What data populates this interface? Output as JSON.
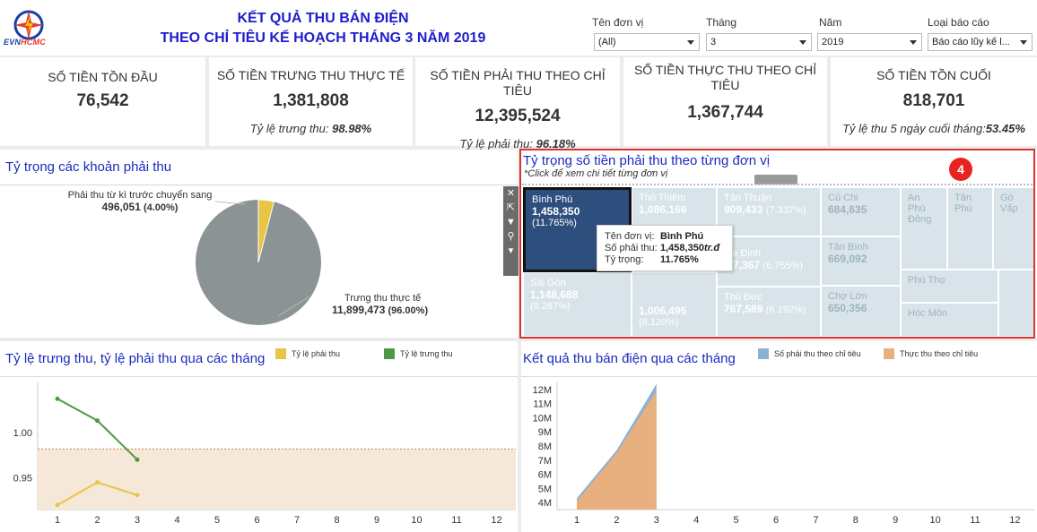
{
  "header": {
    "logo_text_a": "EVN",
    "logo_text_b": "HCMC",
    "title_line1": "KẾT QUẢ THU BÁN ĐIỆN",
    "title_line2": "THEO CHỈ TIÊU KẾ HOẠCH THÁNG 3 NĂM 2019"
  },
  "filters": [
    {
      "label": "Tên đơn vị",
      "value": "(All)"
    },
    {
      "label": "Tháng",
      "value": "3"
    },
    {
      "label": "Năm",
      "value": "2019"
    },
    {
      "label": "Loại báo cáo",
      "value": "Báo cáo lũy kế l..."
    }
  ],
  "kpis": [
    {
      "title": "SỐ TIỀN TỒN ĐẦU",
      "value": "76,542",
      "note_label": "",
      "note_value": ""
    },
    {
      "title": "SỐ TIỀN TRƯNG THU THỰC TẾ",
      "value": "1,381,808",
      "note_label": "Tỷ lệ trưng thu: ",
      "note_value": "98.98%"
    },
    {
      "title": "SỐ TIỀN PHẢI THU THEO CHỈ TIÊU",
      "value": "12,395,524",
      "note_label": "Tỷ lệ phải thu: ",
      "note_value": "96.18%"
    },
    {
      "title": "SỐ TIỀN THỰC THU THEO CHỈ TIÊU",
      "value": "1,367,744",
      "note_label": "",
      "note_value": ""
    },
    {
      "title": "SỐ TIỀN TỒN CUỐI",
      "value": "818,701",
      "note_label": "Tỷ lệ thu 5 ngày cuối tháng:",
      "note_value": "53.45%"
    }
  ],
  "pie_panel": {
    "title": "Tỷ trọng các khoản phải thu",
    "label1_name": "Phải thu từ kì trước chuyển sang",
    "label1_value": "496,051",
    "label1_pct": "(4.00%)",
    "label2_name": "Trưng thu thực tế",
    "label2_value": "11,899,473",
    "label2_pct": "(96.00%)"
  },
  "treemap_panel": {
    "title": "Tỷ trọng số tiền phải thu theo từng đơn vị",
    "subtitle": "*Click để xem chi tiết từng đơn vị",
    "badge": "4",
    "cells": [
      {
        "name": "Bình Phú",
        "value": "1,458,350",
        "pct": "(11.765%)"
      },
      {
        "name": "Thủ Thiêm",
        "value": "1,086,166",
        "pct": ""
      },
      {
        "name": "Tân Thuận",
        "value": "909,433",
        "pct": "(7.337%)"
      },
      {
        "name": "Củ Chi",
        "value": "684,635",
        "pct": ""
      },
      {
        "name": "An Phú Đông",
        "value": "",
        "pct": ""
      },
      {
        "name": "Tân Phú",
        "value": "",
        "pct": ""
      },
      {
        "name": "Gò Vấp",
        "value": "",
        "pct": ""
      },
      {
        "name": "Sài Gòn",
        "value": "1,148,688",
        "pct": "(9.267%)"
      },
      {
        "name": "",
        "value": "1,006,495",
        "pct": "(8.120%)"
      },
      {
        "name": "...a Định",
        "value": "...7,367",
        "pct": "(6.755%)"
      },
      {
        "name": "Tân Bình",
        "value": "669,092",
        "pct": ""
      },
      {
        "name": "Phú Thọ",
        "value": "",
        "pct": ""
      },
      {
        "name": "Thủ Đức",
        "value": "767,589",
        "pct": "(6.192%)"
      },
      {
        "name": "Chợ Lớn",
        "value": "650,356",
        "pct": ""
      },
      {
        "name": "Hóc Môn",
        "value": "",
        "pct": ""
      }
    ],
    "tooltip": {
      "k1": "Tên đơn vị:",
      "v1": "Bình Phú",
      "k2": "Số phải thu:",
      "v2": "1,458,350",
      "v2_unit": " tr.đ",
      "k3": "Tỷ trọng:",
      "v3": "11.765%"
    }
  },
  "toolbar": {
    "close": "✕",
    "open": "⇱",
    "filter": "▼",
    "pin": "⚲",
    "more": "▾"
  },
  "colors": {
    "pie_main": "#8c9394",
    "pie_small": "#e8c547",
    "line_phai": "#e8c547",
    "line_trung": "#4e9a44",
    "area_phai": "#8db0d6",
    "area_thuc": "#e8b07f",
    "treemap_selected": "#2e4e7e",
    "badge": "#e8231f"
  },
  "chart_data": [
    {
      "type": "line",
      "title": "Tỷ lệ trưng thu, tỷ lệ phải thu qua các tháng",
      "x": [
        1,
        2,
        3
      ],
      "x_ticks": [
        "1",
        "2",
        "3",
        "4",
        "5",
        "6",
        "7",
        "8",
        "9",
        "10",
        "11",
        "12"
      ],
      "y_ticks": [
        "1.00",
        "0.95"
      ],
      "ylim": [
        0.915,
        1.055
      ],
      "series": [
        {
          "name": "Tỷ lệ phải thu",
          "values": [
            0.92,
            0.945,
            0.931
          ]
        },
        {
          "name": "Tỷ lệ trưng thu",
          "values": [
            1.037,
            1.013,
            0.97
          ]
        }
      ],
      "reference_line": 0.9818,
      "legend": "top"
    },
    {
      "type": "area",
      "title": "Kết quả thu bán điện qua các tháng",
      "x": [
        1,
        2,
        3
      ],
      "x_ticks": [
        "1",
        "2",
        "3",
        "4",
        "5",
        "6",
        "7",
        "8",
        "9",
        "10",
        "11",
        "12"
      ],
      "y_ticks": [
        "12M",
        "11M",
        "10M",
        "9M",
        "8M",
        "7M",
        "6M",
        "5M",
        "4M"
      ],
      "ylim": [
        3.5,
        12.5
      ],
      "series": [
        {
          "name": "Số phải thu theo chỉ tiêu",
          "values": [
            4.3,
            7.7,
            12.4
          ]
        },
        {
          "name": "Thực thu theo chỉ tiêu",
          "values": [
            4.1,
            7.5,
            11.9
          ]
        }
      ],
      "legend": "top"
    }
  ]
}
